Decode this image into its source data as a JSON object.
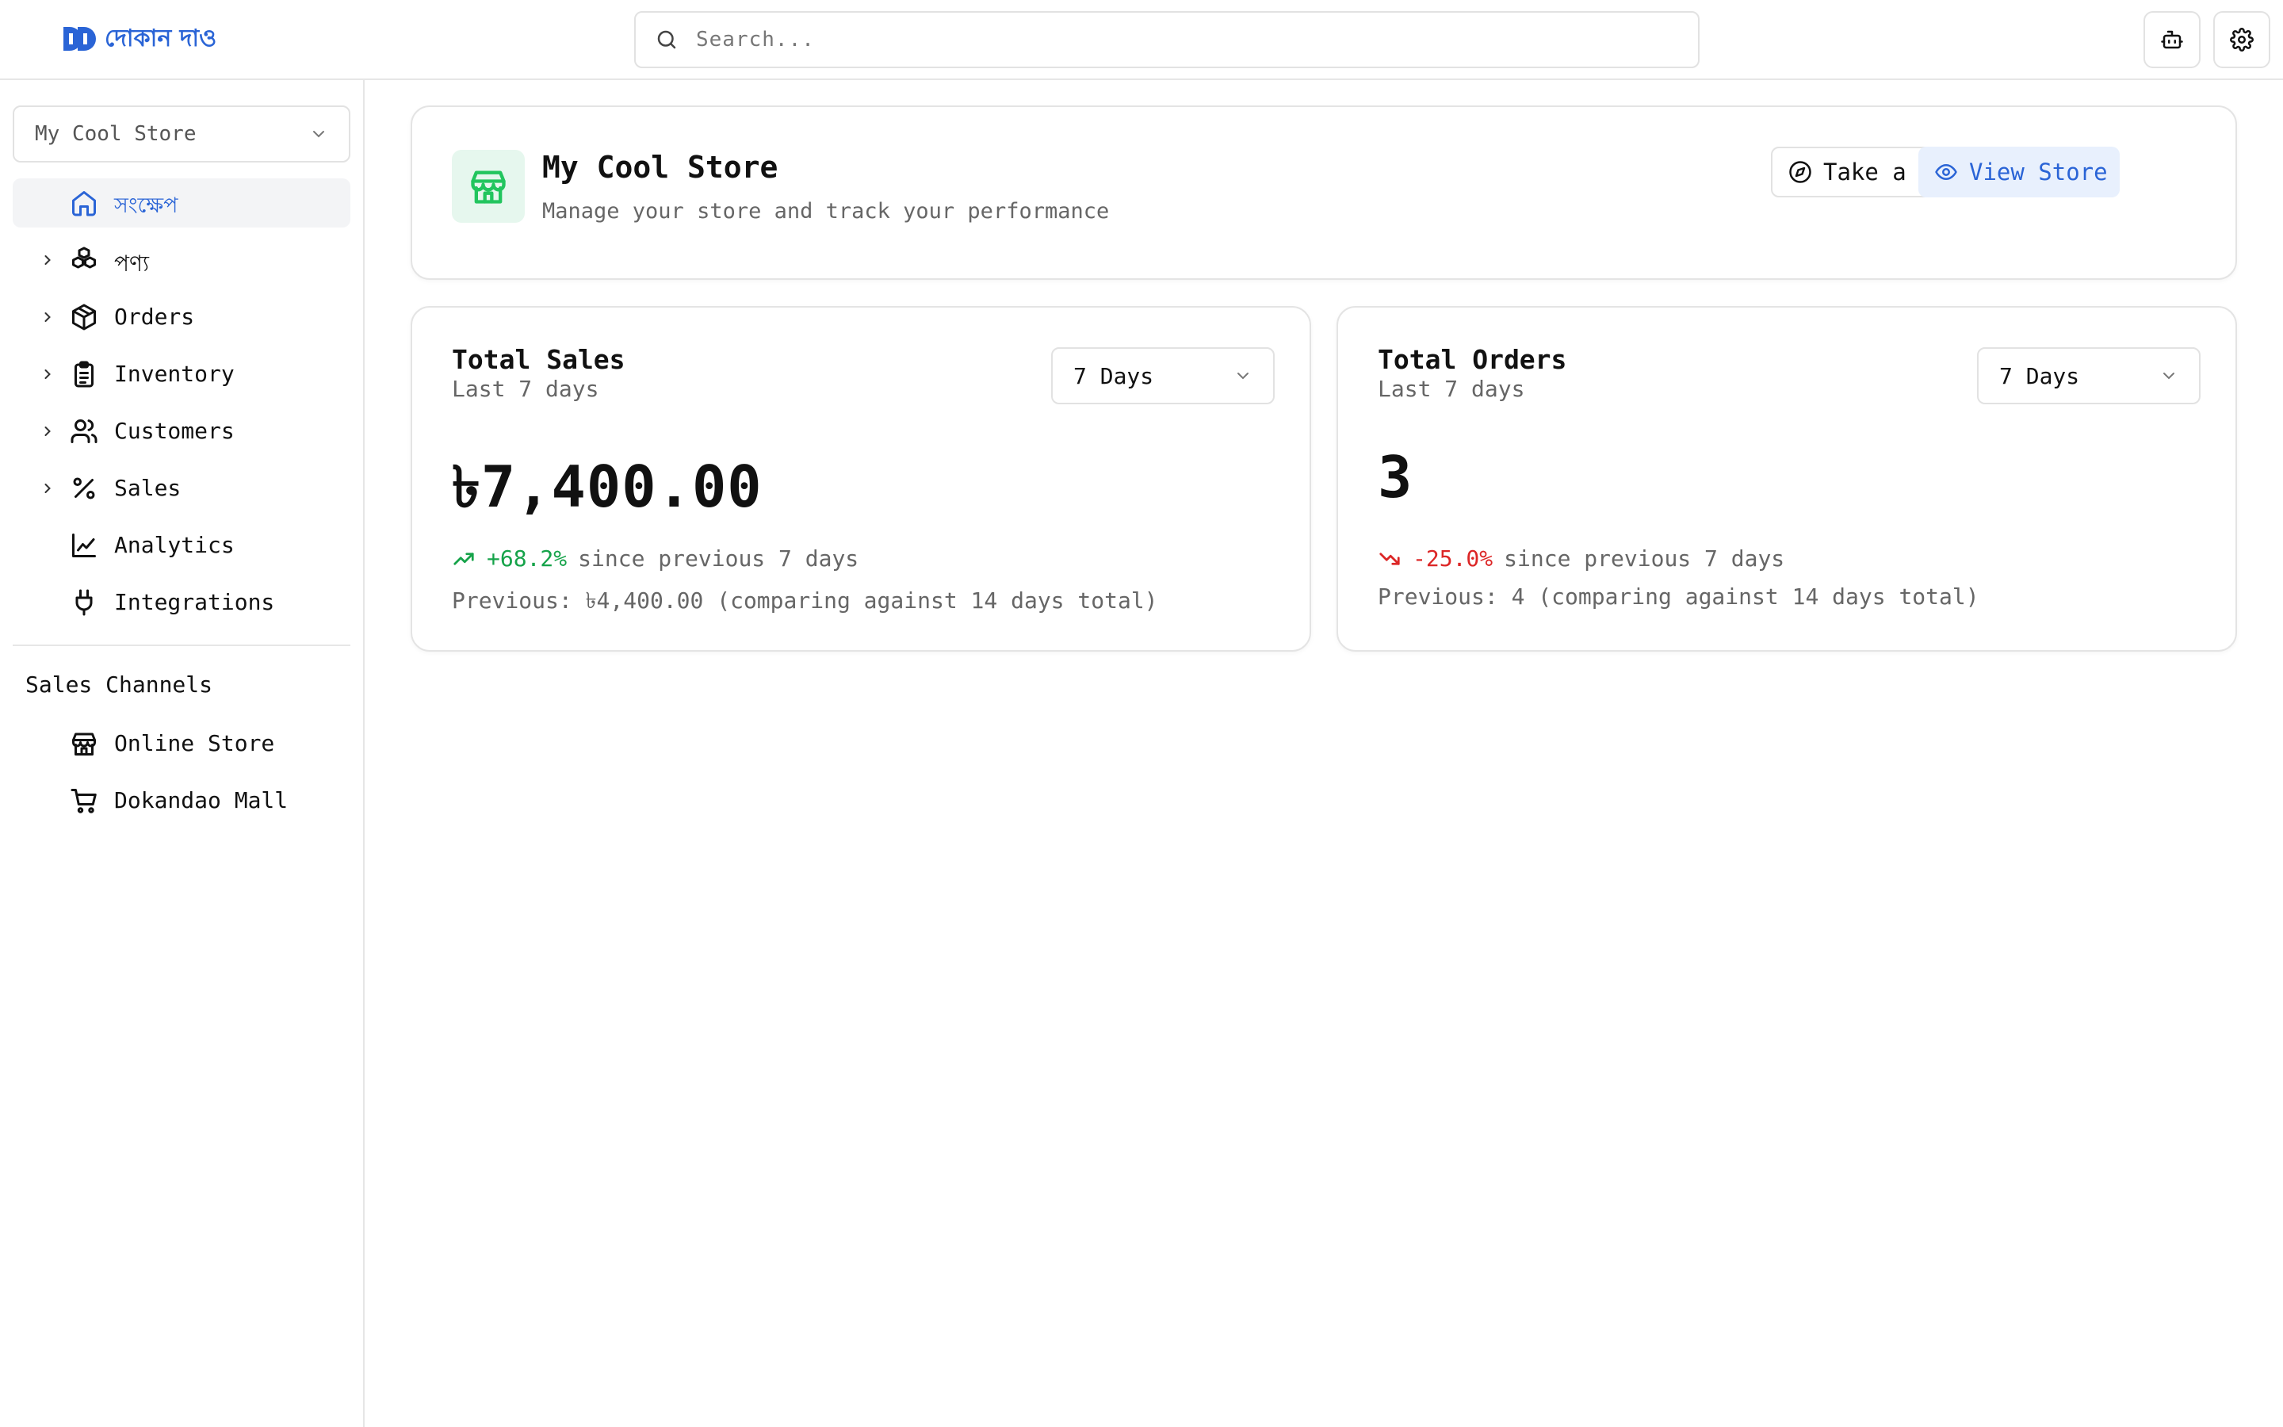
{
  "brand": {
    "name": "দোকান দাও",
    "color": "#2a64d6",
    "logo_icon": "brand-dd-logo"
  },
  "search": {
    "placeholder": "Search..."
  },
  "topbar_actions": {
    "assistant_icon": "bot-icon",
    "settings_icon": "gear-icon"
  },
  "sidebar": {
    "store_selector": {
      "value": "My Cool Store"
    },
    "nav": [
      {
        "label": "সংক্ষেপ",
        "icon": "home-icon",
        "active": true,
        "expandable": false
      },
      {
        "label": "পণ্য",
        "icon": "boxes-icon",
        "expandable": true
      },
      {
        "label": "Orders",
        "icon": "package-icon",
        "expandable": true
      },
      {
        "label": "Inventory",
        "icon": "clipboard-icon",
        "expandable": true
      },
      {
        "label": "Customers",
        "icon": "users-icon",
        "expandable": true
      },
      {
        "label": "Sales",
        "icon": "percent-icon",
        "expandable": true
      },
      {
        "label": "Analytics",
        "icon": "chart-line-icon",
        "expandable": false
      },
      {
        "label": "Integrations",
        "icon": "plug-icon",
        "expandable": false
      }
    ],
    "channels_title": "Sales Channels",
    "channels": [
      {
        "label": "Online Store",
        "icon": "store-icon"
      },
      {
        "label": "Dokandao Mall",
        "icon": "cart-icon"
      }
    ]
  },
  "header": {
    "title": "My Cool Store",
    "subtitle": "Manage your store and track your performance",
    "tour_label": "Take a Tour",
    "view_label": "View Store"
  },
  "stats": {
    "sales": {
      "title": "Total Sales",
      "subtitle": "Last 7 days",
      "period": "7 Days",
      "value": "৳7,400.00",
      "change": "+68.2%",
      "change_direction": "up",
      "change_suffix": "since previous 7 days",
      "previous": "Previous: ৳4,400.00 (comparing against 14 days total)"
    },
    "orders": {
      "title": "Total Orders",
      "subtitle": "Last 7 days",
      "period": "7 Days",
      "value": "3",
      "change": "-25.0%",
      "change_direction": "down",
      "change_suffix": "since previous 7 days",
      "previous": "Previous: 4 (comparing against 14 days total)"
    }
  },
  "colors": {
    "accent": "#2a64d6",
    "positive": "#16a34a",
    "negative": "#dc2626",
    "store_badge": "#22c55e"
  }
}
